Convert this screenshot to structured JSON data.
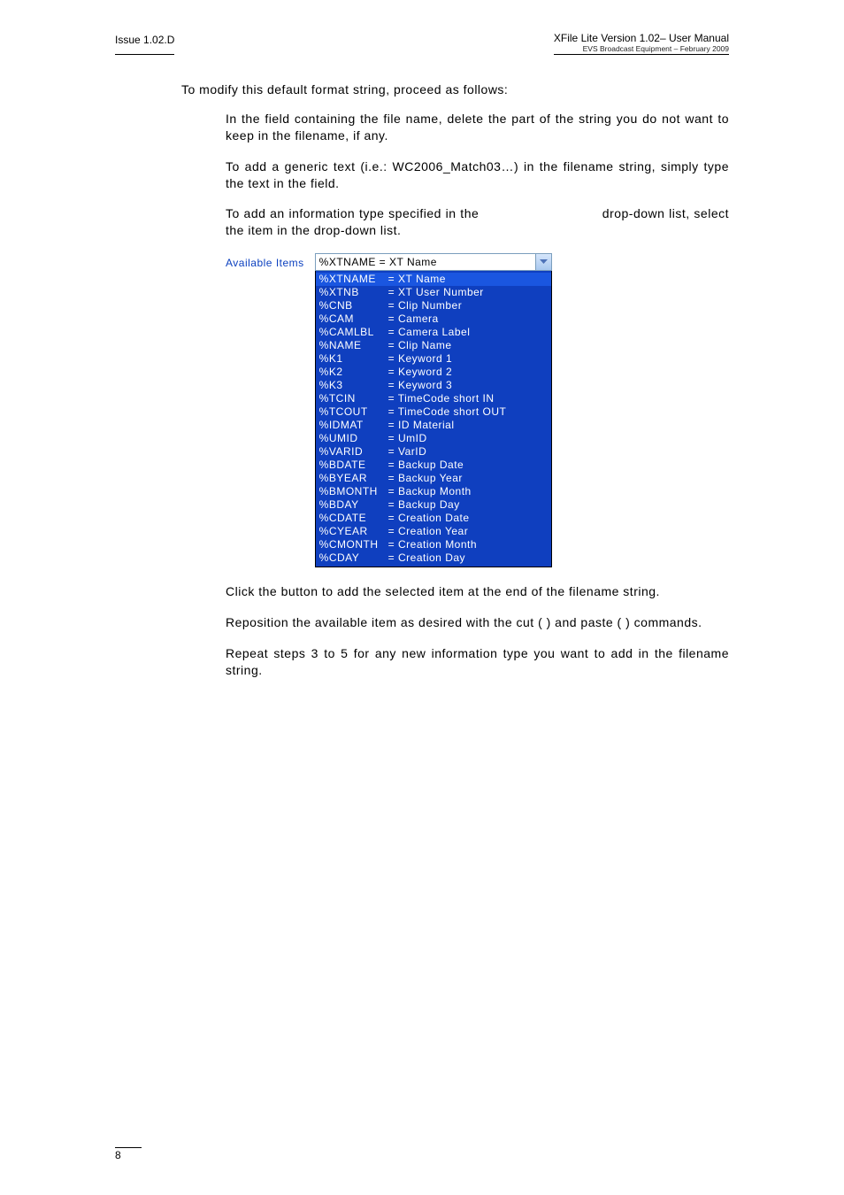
{
  "header": {
    "issue": "Issue 1.02.D",
    "title": "XFile Lite Version 1.02– User Manual",
    "sub": "EVS Broadcast Equipment – February 2009"
  },
  "intro": "To modify this default format string, proceed as follows:",
  "p1": "In the field containing the file name, delete the part of the string you do not want to keep in the filename, if any.",
  "p2": "To add a generic text (i.e.: WC2006_Match03…) in the filename string, simply type the text in the field.",
  "p3a": "To add an information type specified in the ",
  "p3b": " drop-down list, select the item in the drop-down list.",
  "avail_label": "Available Items",
  "combo_value": "%XTNAME   = XT Name",
  "items": [
    {
      "k": "%XTNAME",
      "v": "= XT Name",
      "sel": true
    },
    {
      "k": "%XTNB",
      "v": "= XT User Number"
    },
    {
      "k": "%CNB",
      "v": "= Clip Number"
    },
    {
      "k": "%CAM",
      "v": "= Camera"
    },
    {
      "k": "%CAMLBL",
      "v": "= Camera Label"
    },
    {
      "k": "%NAME",
      "v": "= Clip Name"
    },
    {
      "k": "%K1",
      "v": "= Keyword 1"
    },
    {
      "k": "%K2",
      "v": "= Keyword 2"
    },
    {
      "k": "%K3",
      "v": "= Keyword 3"
    },
    {
      "k": "%TCIN",
      "v": "= TimeCode short IN"
    },
    {
      "k": "%TCOUT",
      "v": "= TimeCode short OUT"
    },
    {
      "k": "%IDMAT",
      "v": "= ID Material"
    },
    {
      "k": "%UMID",
      "v": "= UmID"
    },
    {
      "k": "%VARID",
      "v": "= VarID"
    },
    {
      "k": "%BDATE",
      "v": "= Backup Date"
    },
    {
      "k": "%BYEAR",
      "v": "= Backup Year"
    },
    {
      "k": "%BMONTH",
      "v": "= Backup Month"
    },
    {
      "k": "%BDAY",
      "v": "= Backup Day"
    },
    {
      "k": "%CDATE",
      "v": "= Creation Date"
    },
    {
      "k": "%CYEAR",
      "v": "= Creation Year"
    },
    {
      "k": "%CMONTH",
      "v": "= Creation Month"
    },
    {
      "k": "%CDAY",
      "v": "= Creation Day"
    }
  ],
  "p4": "Click the            button to add the selected item at the end of the filename string.",
  "p5": "Reposition the available item as desired with the cut (          ) and paste (          ) commands.",
  "p6": "Repeat steps 3 to 5 for any new information type you want to add in the filename string.",
  "page_number": "8"
}
